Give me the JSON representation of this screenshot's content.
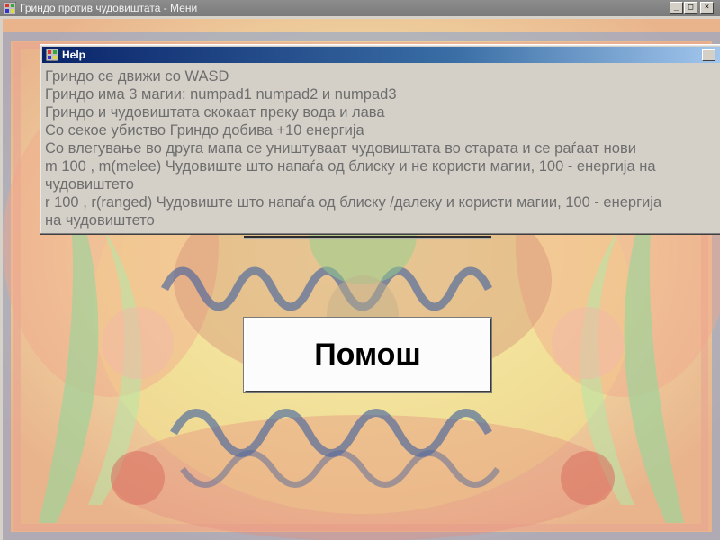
{
  "main_window": {
    "title": "Гриндо против чудовиштата - Мени",
    "controls": {
      "minimize": "_",
      "maximize": "□",
      "close": "×"
    },
    "help_button_label": "Помош"
  },
  "help_window": {
    "title": "Help",
    "controls": {
      "minimize": "_"
    },
    "lines": [
      "Гриндо се движи со WASD",
      "Гриндо има 3 магии: numpad1 numpad2 и numpad3",
      "Гриндо и чудовиштата скокаат преку вода и лава",
      "Со секое убиство Гриндо добива +10 енергија",
      "Со влегување во друга мапа се уништуваат чудовиштата во старата и се раѓаат нови",
      "m 100 , m(melee) Чудовиште што напаѓа од блиску и не користи магии, 100 - енергија на",
      "чудовиштето",
      "r 100 , r(ranged) Чудовиште што напаѓа од блиску /далеку и користи магии, 100 - енергија",
      "на чудовиштето"
    ]
  },
  "colors": {
    "help_title_gradient_start": "#0a246a",
    "help_title_gradient_end": "#a6caf0",
    "help_text": "#6e6e6e"
  },
  "icons": [
    "app-window-icon",
    "minimize-icon",
    "maximize-icon",
    "close-icon"
  ]
}
